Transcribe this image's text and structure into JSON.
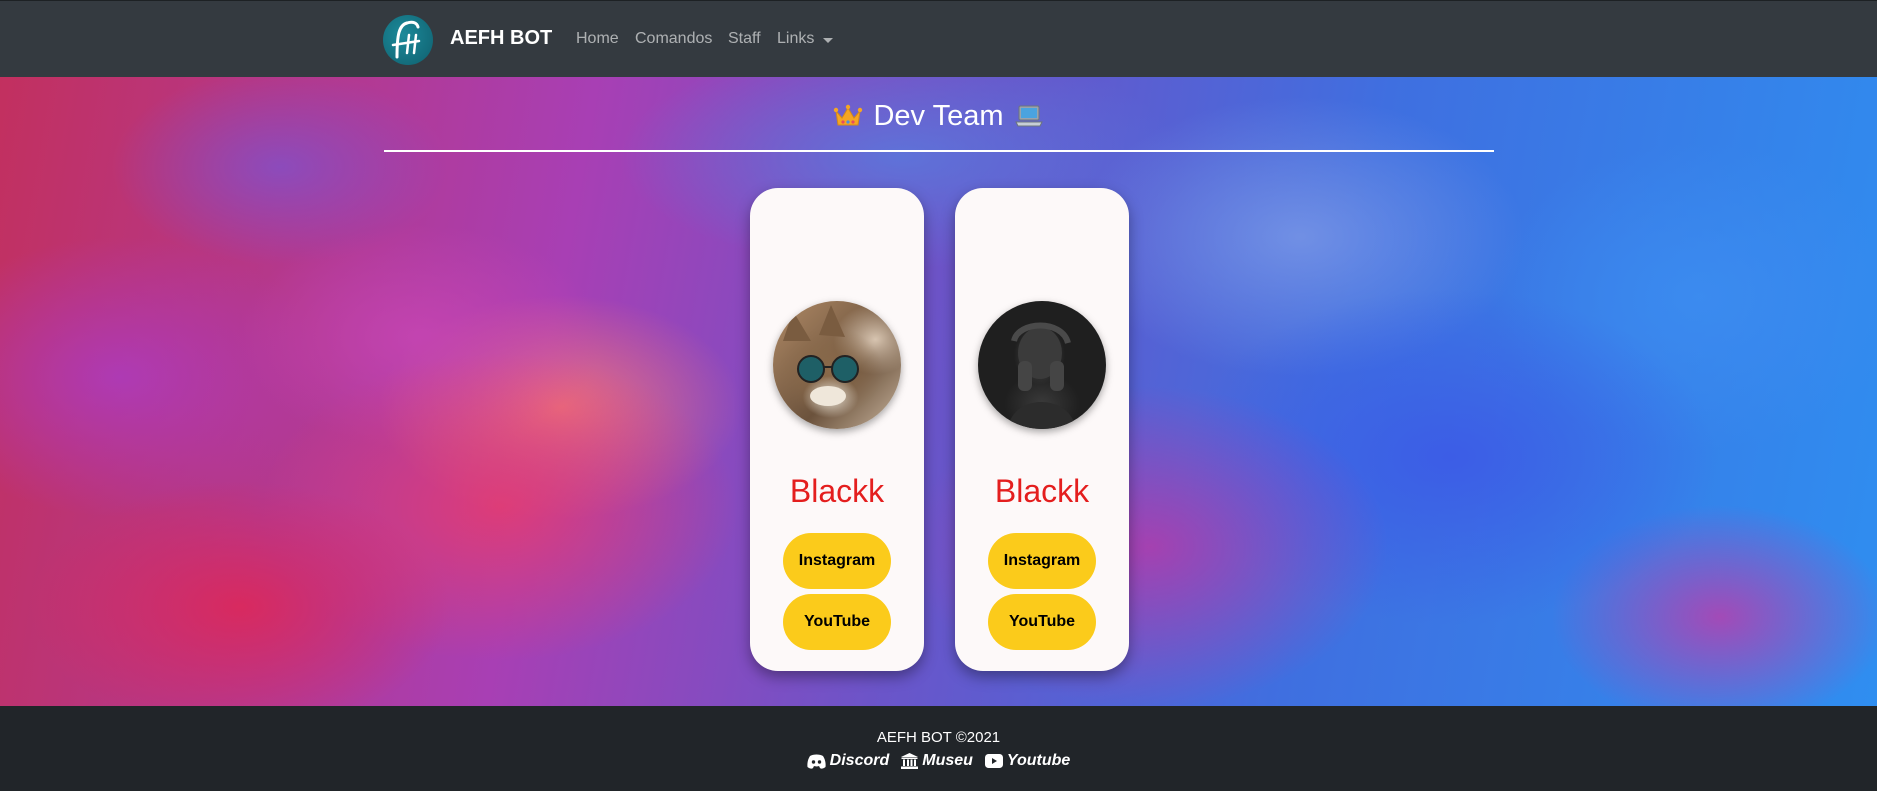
{
  "navbar": {
    "brand_name": "AEFH BOT",
    "logo_icon": "aefh-logo-icon",
    "links": [
      "Home",
      "Comandos",
      "Staff",
      "Links"
    ]
  },
  "hero": {
    "title": "Dev Team",
    "title_icons": [
      "crown-icon",
      "laptop-icon"
    ]
  },
  "cards": [
    {
      "name": "Blackk",
      "avatar": "cat-with-sunglasses",
      "buttons": [
        "Instagram",
        "YouTube"
      ]
    },
    {
      "name": "Blackk",
      "avatar": "dark-portrait",
      "buttons": [
        "Instagram",
        "YouTube"
      ]
    }
  ],
  "footer": {
    "copyright": "AEFH BOT ©2021",
    "links": [
      {
        "label": "Discord",
        "icon": "discord-icon"
      },
      {
        "label": "Museu",
        "icon": "museum-icon"
      },
      {
        "label": "Youtube",
        "icon": "youtube-icon"
      }
    ]
  },
  "colors": {
    "navbar_bg": "#343a40",
    "footer_bg": "#212529",
    "card_name": "#e41e1e",
    "button_bg": "#fbcb1b"
  }
}
